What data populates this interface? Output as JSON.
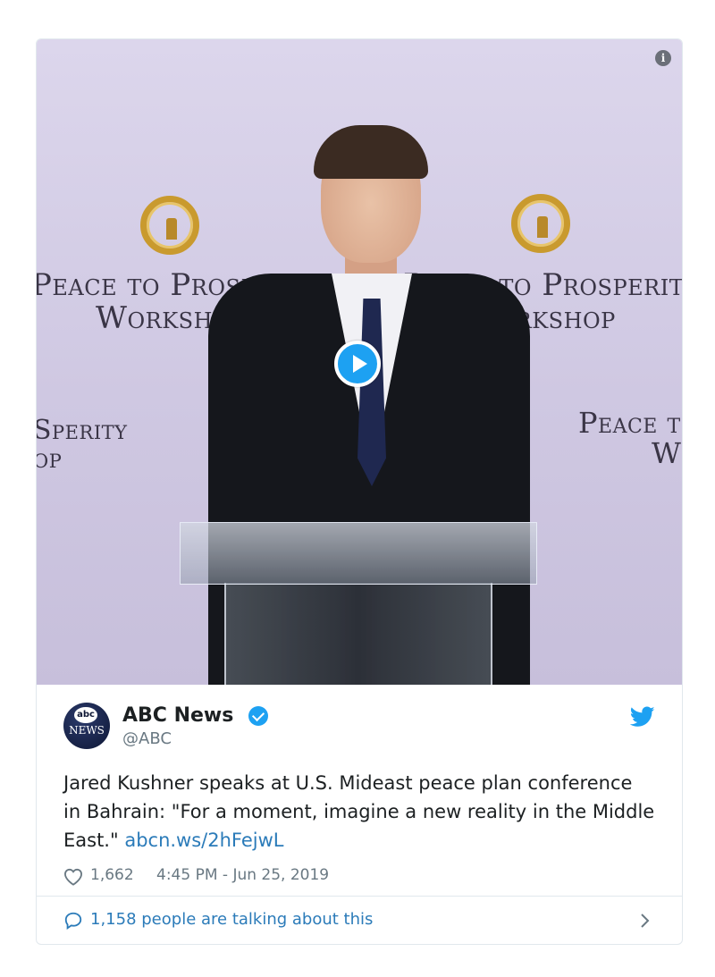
{
  "media": {
    "backdrop_lines": [
      "Peace to Prosperity",
      "Workshop"
    ],
    "backdrop_lines_b": [
      "Sperity",
      "op"
    ],
    "backdrop_lines_c": [
      "Peace t",
      "W"
    ],
    "backdrop_letter": "P"
  },
  "author": {
    "avatar_top": "abc",
    "avatar_bottom": "NEWS",
    "name": "ABC News",
    "handle": "@ABC"
  },
  "tweet": {
    "text": "Jared Kushner speaks at U.S. Mideast peace plan conference in Bahrain: \"For a moment, imagine a new reality in the Middle East.\" ",
    "link_text": "abcn.ws/2hFejwL",
    "likes": "1,662",
    "timestamp": "4:45 PM - Jun 25, 2019"
  },
  "conversation": {
    "label": "1,158 people are talking about this"
  },
  "colors": {
    "accent": "#1da1f2",
    "link": "#2b7bb9",
    "muted": "#697882"
  },
  "icons": [
    "info-icon",
    "play-icon",
    "verified-icon",
    "twitter-bird-icon",
    "heart-icon",
    "reply-icon",
    "chevron-right-icon"
  ]
}
